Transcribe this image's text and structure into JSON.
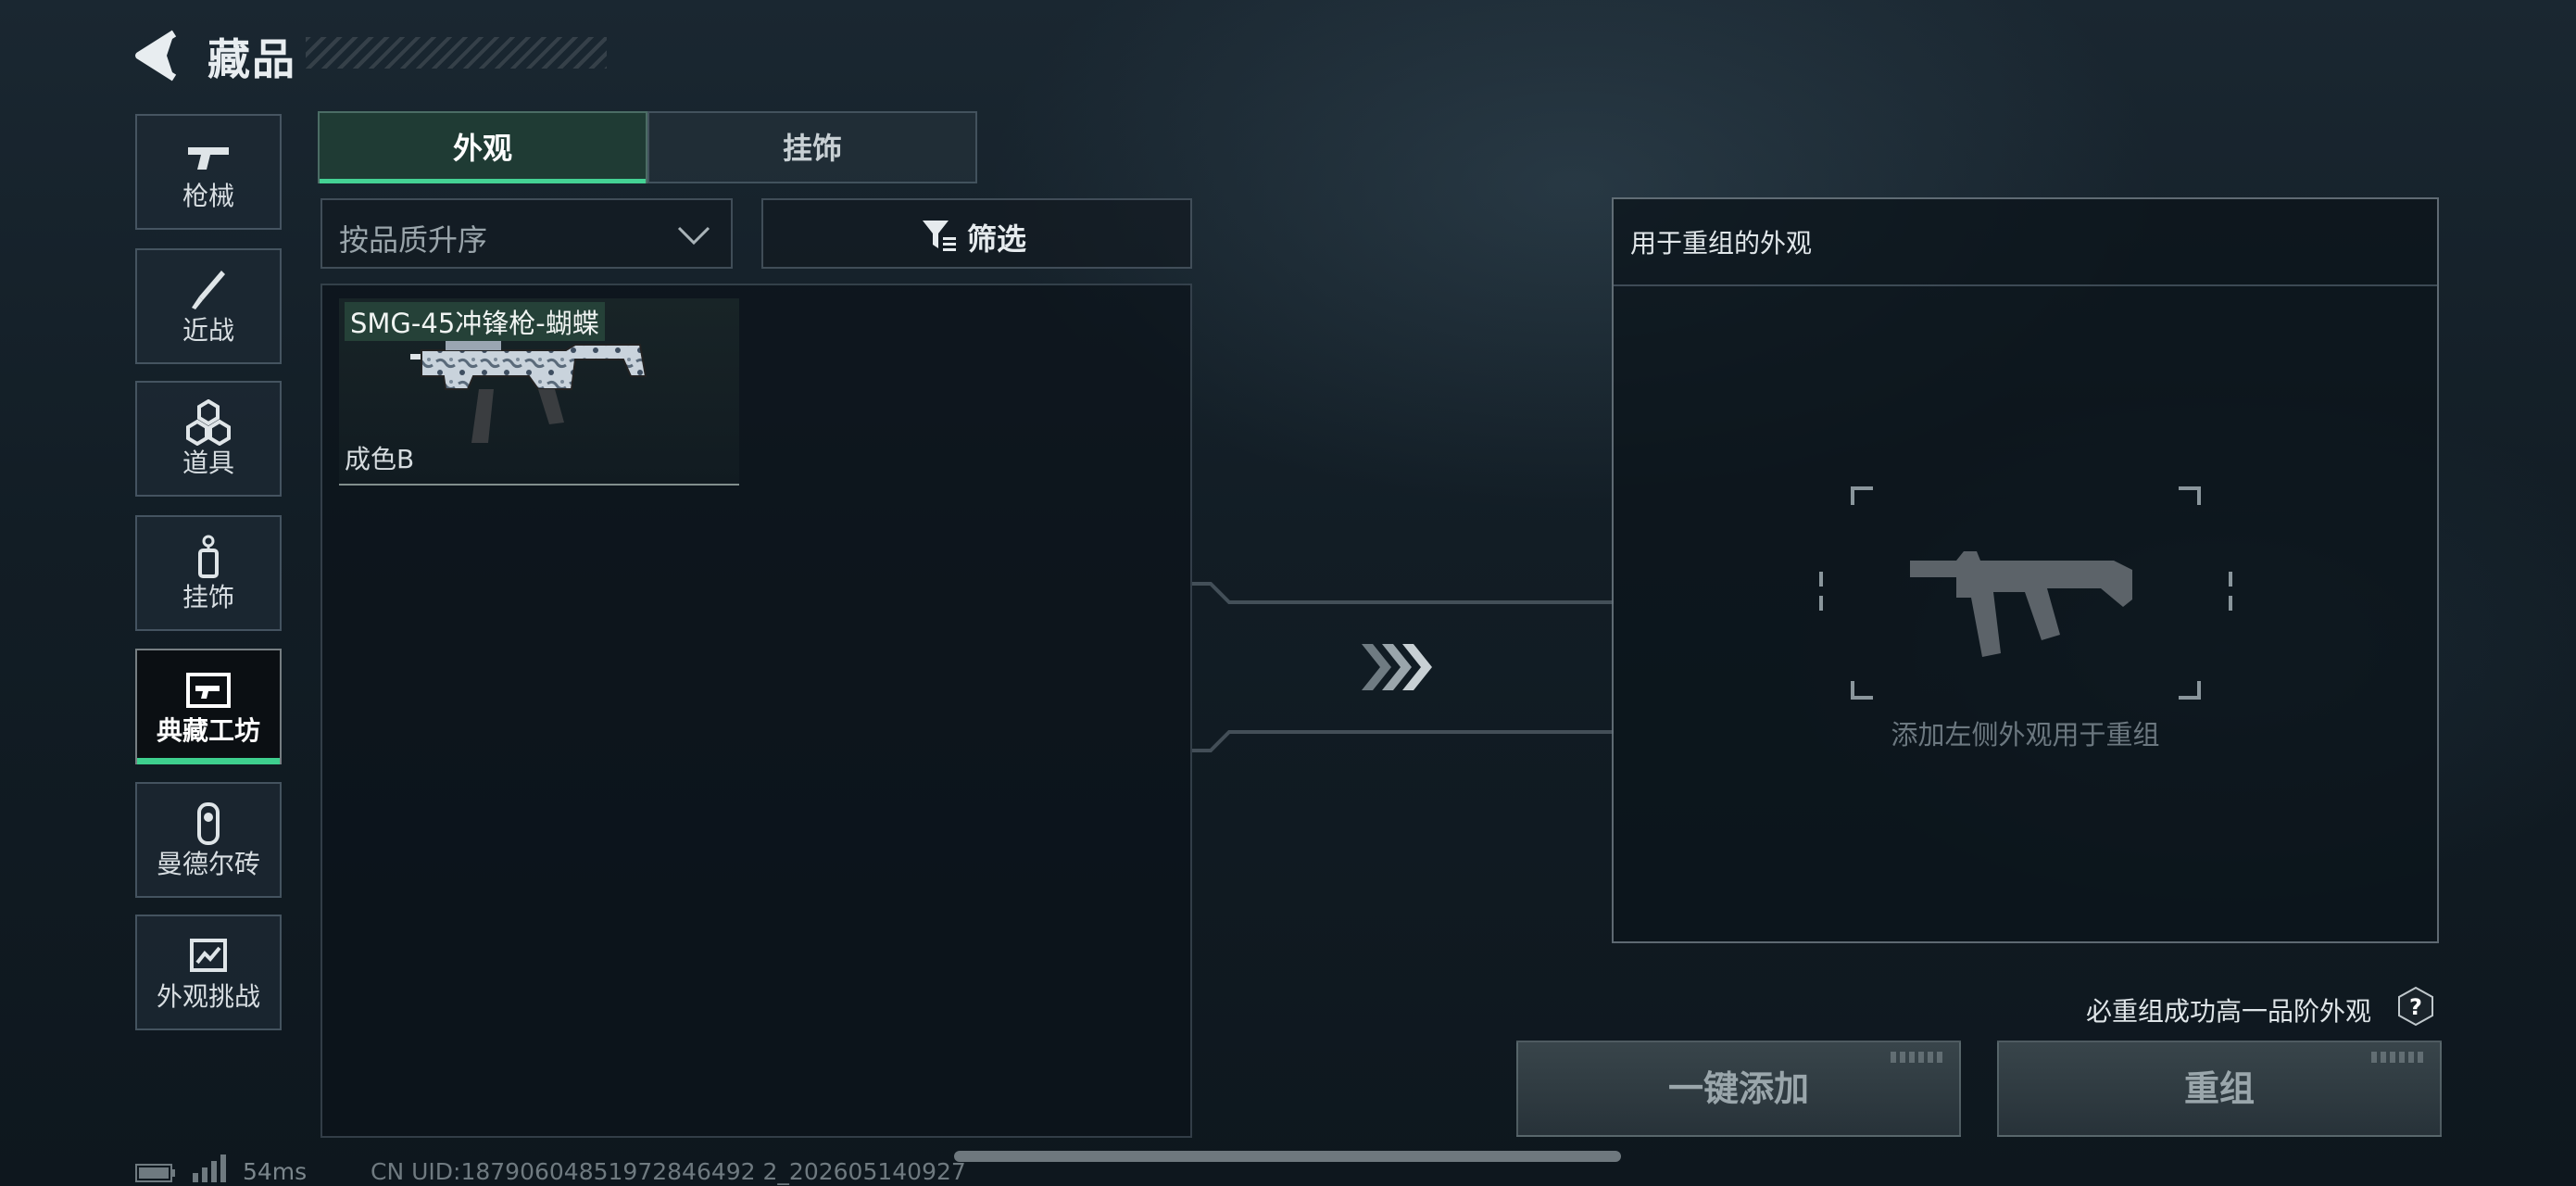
{
  "header": {
    "title": "藏品"
  },
  "sidebar": {
    "items": [
      {
        "label": "枪械",
        "icon": "pistol-icon"
      },
      {
        "label": "近战",
        "icon": "knife-icon"
      },
      {
        "label": "道具",
        "icon": "items-icon"
      },
      {
        "label": "挂饰",
        "icon": "charm-icon"
      },
      {
        "label": "典藏工坊",
        "icon": "workshop-icon",
        "active": true
      },
      {
        "label": "曼德尔砖",
        "icon": "mandel-brick-icon"
      },
      {
        "label": "外观挑战",
        "icon": "challenge-icon"
      }
    ]
  },
  "tabs": [
    {
      "label": "外观",
      "active": true
    },
    {
      "label": "挂饰",
      "active": false
    }
  ],
  "sort": {
    "label": "按品质升序"
  },
  "filter": {
    "label": "筛选"
  },
  "list": {
    "items": [
      {
        "name": "SMG-45冲锋枪-蝴蝶",
        "grade": "成色B"
      }
    ]
  },
  "reassemble": {
    "title": "用于重组的外观",
    "hint": "添加左侧外观用于重组"
  },
  "actions": {
    "note": "必重组成功高一品阶外观",
    "add_all": "一键添加",
    "regroup": "重组"
  },
  "status": {
    "ping": "54ms",
    "uid": "CN UID:18790604851972846492 2_202605140927"
  },
  "colors": {
    "accent": "#3ecf8e",
    "tab_active_bg": "#1f3b34"
  }
}
